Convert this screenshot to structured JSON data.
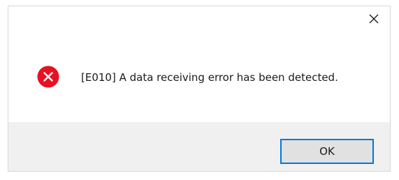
{
  "dialog": {
    "message": "[E010] A data receiving error has been detected.",
    "icon": "error-icon",
    "ok_label": "OK",
    "close_icon": "close-icon"
  },
  "colors": {
    "error_red": "#e81123",
    "accent_blue": "#0078d7",
    "footer_bg": "#f0f0f0"
  }
}
